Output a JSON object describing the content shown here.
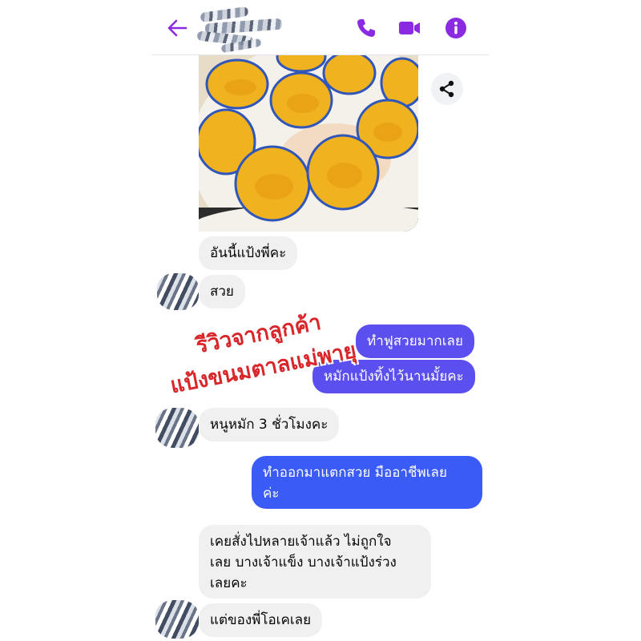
{
  "header": {
    "back_icon": "arrow-left-icon",
    "call_icon": "phone-icon",
    "video_icon": "video-camera-icon",
    "info_icon": "info-icon",
    "accent_color": "#8a2be2"
  },
  "thread": {
    "photo": {
      "subject": "photo",
      "share_icon": "share-icon"
    },
    "messages": [
      {
        "side": "in",
        "text": "อันนี้แป้งพี่คะ"
      },
      {
        "side": "in",
        "text": "สวย"
      },
      {
        "side": "out",
        "text": "ทำฟูสวยมากเลย"
      },
      {
        "side": "out",
        "text": "หมักแป้งทิ้งไว้นานมั้ยคะ"
      },
      {
        "side": "in",
        "text": "หนูหมัก 3 ชั่วโมงคะ"
      },
      {
        "side": "out",
        "line1": "ทำออกมาแตกสวย มืออาชีพเลย",
        "line2": "ค่ะ"
      },
      {
        "side": "in",
        "line1": "เคยสั่งไปหลายเจ้าแล้ว ไม่ถูกใจ",
        "line2": "เลย บางเจ้าแข็ง บางเจ้าแป้งร่วง",
        "line3": "เลยคะ"
      },
      {
        "side": "in",
        "text": "แต่ของพี่โอเคเลย"
      }
    ]
  },
  "overlay": {
    "line1": "รีวิวจากลูกค้า",
    "line2": "แป้งขนมตาลแม่พายุ",
    "color": "#d8262a"
  }
}
